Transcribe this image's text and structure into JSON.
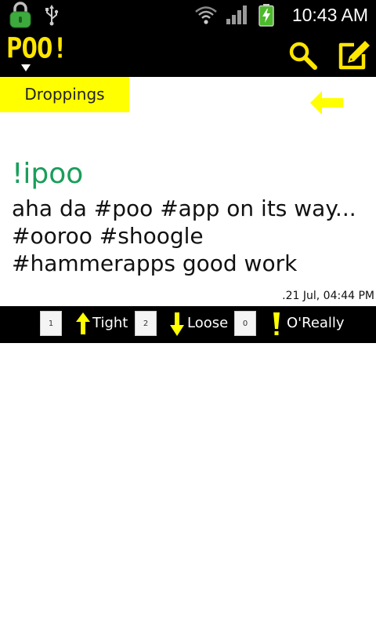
{
  "status_bar": {
    "time": "10:43 AM",
    "icons": [
      "lock-icon",
      "usb-icon",
      "wifi-icon",
      "signal-icon",
      "battery-charging-icon"
    ]
  },
  "action_bar": {
    "logo": "POO!",
    "icons": [
      "search-icon",
      "compose-icon"
    ]
  },
  "tabs": {
    "active_label": "Droppings",
    "back_icon": "back-arrow-icon"
  },
  "post": {
    "user": "!ipoo",
    "text": "aha da #poo #app on its way... #ooroo #shoogle #hammerapps good work",
    "timestamp": ".21 Jul, 04:44 PM"
  },
  "votes": {
    "tight": {
      "count": "1",
      "label": "Tight"
    },
    "loose": {
      "count": "2",
      "label": "Loose"
    },
    "oreally": {
      "count": "0",
      "label": "O'Really"
    }
  },
  "colors": {
    "accent_yellow": "#ffff00",
    "logo_yellow": "#ffe600",
    "username_green": "#1a9e5a",
    "bar_black": "#000000"
  }
}
